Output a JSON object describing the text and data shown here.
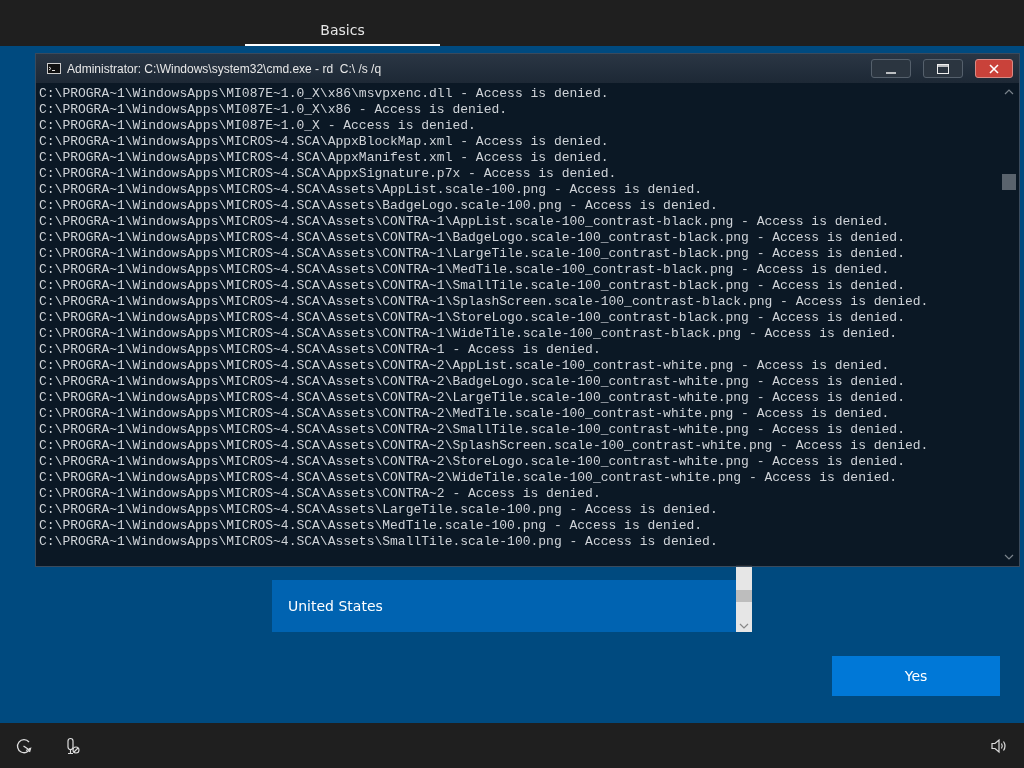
{
  "header": {
    "tabs": [
      {
        "label": "Basics",
        "selected": true
      }
    ]
  },
  "region_list": {
    "items": [
      {
        "label": "United States",
        "selected": true
      }
    ]
  },
  "yes_button": {
    "label": "Yes"
  },
  "cmd_window": {
    "title": "Administrator: C:\\Windows\\system32\\cmd.exe - rd  C:\\ /s /q",
    "lines": [
      "C:\\PROGRA~1\\WindowsApps\\MI087E~1.0_X\\x86\\msvpxenc.dll - Access is denied.",
      "C:\\PROGRA~1\\WindowsApps\\MI087E~1.0_X\\x86 - Access is denied.",
      "C:\\PROGRA~1\\WindowsApps\\MI087E~1.0_X - Access is denied.",
      "C:\\PROGRA~1\\WindowsApps\\MICROS~4.SCA\\AppxBlockMap.xml - Access is denied.",
      "C:\\PROGRA~1\\WindowsApps\\MICROS~4.SCA\\AppxManifest.xml - Access is denied.",
      "C:\\PROGRA~1\\WindowsApps\\MICROS~4.SCA\\AppxSignature.p7x - Access is denied.",
      "C:\\PROGRA~1\\WindowsApps\\MICROS~4.SCA\\Assets\\AppList.scale-100.png - Access is denied.",
      "C:\\PROGRA~1\\WindowsApps\\MICROS~4.SCA\\Assets\\BadgeLogo.scale-100.png - Access is denied.",
      "C:\\PROGRA~1\\WindowsApps\\MICROS~4.SCA\\Assets\\CONTRA~1\\AppList.scale-100_contrast-black.png - Access is denied.",
      "C:\\PROGRA~1\\WindowsApps\\MICROS~4.SCA\\Assets\\CONTRA~1\\BadgeLogo.scale-100_contrast-black.png - Access is denied.",
      "C:\\PROGRA~1\\WindowsApps\\MICROS~4.SCA\\Assets\\CONTRA~1\\LargeTile.scale-100_contrast-black.png - Access is denied.",
      "C:\\PROGRA~1\\WindowsApps\\MICROS~4.SCA\\Assets\\CONTRA~1\\MedTile.scale-100_contrast-black.png - Access is denied.",
      "C:\\PROGRA~1\\WindowsApps\\MICROS~4.SCA\\Assets\\CONTRA~1\\SmallTile.scale-100_contrast-black.png - Access is denied.",
      "C:\\PROGRA~1\\WindowsApps\\MICROS~4.SCA\\Assets\\CONTRA~1\\SplashScreen.scale-100_contrast-black.png - Access is denied.",
      "C:\\PROGRA~1\\WindowsApps\\MICROS~4.SCA\\Assets\\CONTRA~1\\StoreLogo.scale-100_contrast-black.png - Access is denied.",
      "C:\\PROGRA~1\\WindowsApps\\MICROS~4.SCA\\Assets\\CONTRA~1\\WideTile.scale-100_contrast-black.png - Access is denied.",
      "C:\\PROGRA~1\\WindowsApps\\MICROS~4.SCA\\Assets\\CONTRA~1 - Access is denied.",
      "C:\\PROGRA~1\\WindowsApps\\MICROS~4.SCA\\Assets\\CONTRA~2\\AppList.scale-100_contrast-white.png - Access is denied.",
      "C:\\PROGRA~1\\WindowsApps\\MICROS~4.SCA\\Assets\\CONTRA~2\\BadgeLogo.scale-100_contrast-white.png - Access is denied.",
      "C:\\PROGRA~1\\WindowsApps\\MICROS~4.SCA\\Assets\\CONTRA~2\\LargeTile.scale-100_contrast-white.png - Access is denied.",
      "C:\\PROGRA~1\\WindowsApps\\MICROS~4.SCA\\Assets\\CONTRA~2\\MedTile.scale-100_contrast-white.png - Access is denied.",
      "C:\\PROGRA~1\\WindowsApps\\MICROS~4.SCA\\Assets\\CONTRA~2\\SmallTile.scale-100_contrast-white.png - Access is denied.",
      "C:\\PROGRA~1\\WindowsApps\\MICROS~4.SCA\\Assets\\CONTRA~2\\SplashScreen.scale-100_contrast-white.png - Access is denied.",
      "C:\\PROGRA~1\\WindowsApps\\MICROS~4.SCA\\Assets\\CONTRA~2\\StoreLogo.scale-100_contrast-white.png - Access is denied.",
      "C:\\PROGRA~1\\WindowsApps\\MICROS~4.SCA\\Assets\\CONTRA~2\\WideTile.scale-100_contrast-white.png - Access is denied.",
      "C:\\PROGRA~1\\WindowsApps\\MICROS~4.SCA\\Assets\\CONTRA~2 - Access is denied.",
      "C:\\PROGRA~1\\WindowsApps\\MICROS~4.SCA\\Assets\\LargeTile.scale-100.png - Access is denied.",
      "C:\\PROGRA~1\\WindowsApps\\MICROS~4.SCA\\Assets\\MedTile.scale-100.png - Access is denied.",
      "C:\\PROGRA~1\\WindowsApps\\MICROS~4.SCA\\Assets\\SmallTile.scale-100.png - Access is denied."
    ]
  }
}
